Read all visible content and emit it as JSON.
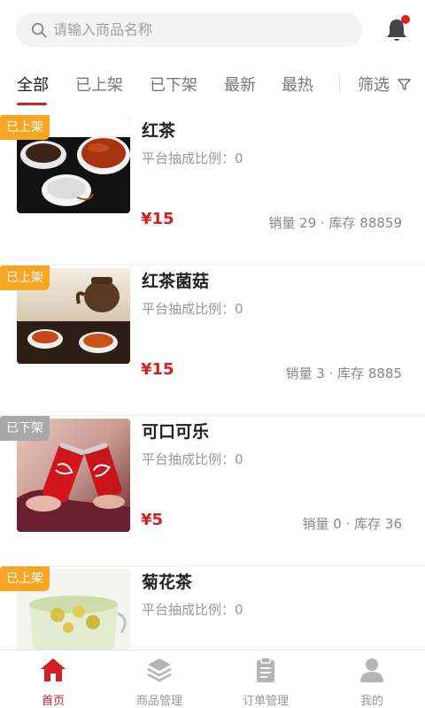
{
  "search": {
    "placeholder": "请输入商品名称",
    "icon": "search-icon"
  },
  "header": {
    "bell_icon": "bell-icon",
    "has_notification": true
  },
  "tabs": [
    {
      "label": "全部",
      "active": true
    },
    {
      "label": "已上架"
    },
    {
      "label": "已下架"
    },
    {
      "label": "最新"
    },
    {
      "label": "最热"
    }
  ],
  "filter": {
    "label": "筛选",
    "icon": "funnel-icon"
  },
  "products": [
    {
      "status": "已上架",
      "name": "红茶",
      "rate": "平台抽成比例：0",
      "price": "¥15",
      "stats": "销量 29 · 库存 88859"
    },
    {
      "status": "已上架",
      "name": "红茶菌菇",
      "rate": "平台抽成比例：0",
      "price": "¥15",
      "stats": "销量 3 · 库存 8885"
    },
    {
      "status": "已下架",
      "name": "可口可乐",
      "rate": "平台抽成比例：0",
      "price": "¥5",
      "stats": "销量 0 · 库存 36"
    },
    {
      "status": "已上架",
      "name": "菊花茶",
      "rate": "平台抽成比例：0",
      "price": "",
      "stats": ""
    }
  ],
  "nav": [
    {
      "label": "首页",
      "icon": "home-icon",
      "active": true
    },
    {
      "label": "商品管理",
      "icon": "layers-icon"
    },
    {
      "label": "订单管理",
      "icon": "clipboard-icon"
    },
    {
      "label": "我的",
      "icon": "user-icon"
    }
  ],
  "colors": {
    "accent": "#d32020",
    "badge_on": "#f6a623",
    "badge_off": "#a8a8a8"
  }
}
